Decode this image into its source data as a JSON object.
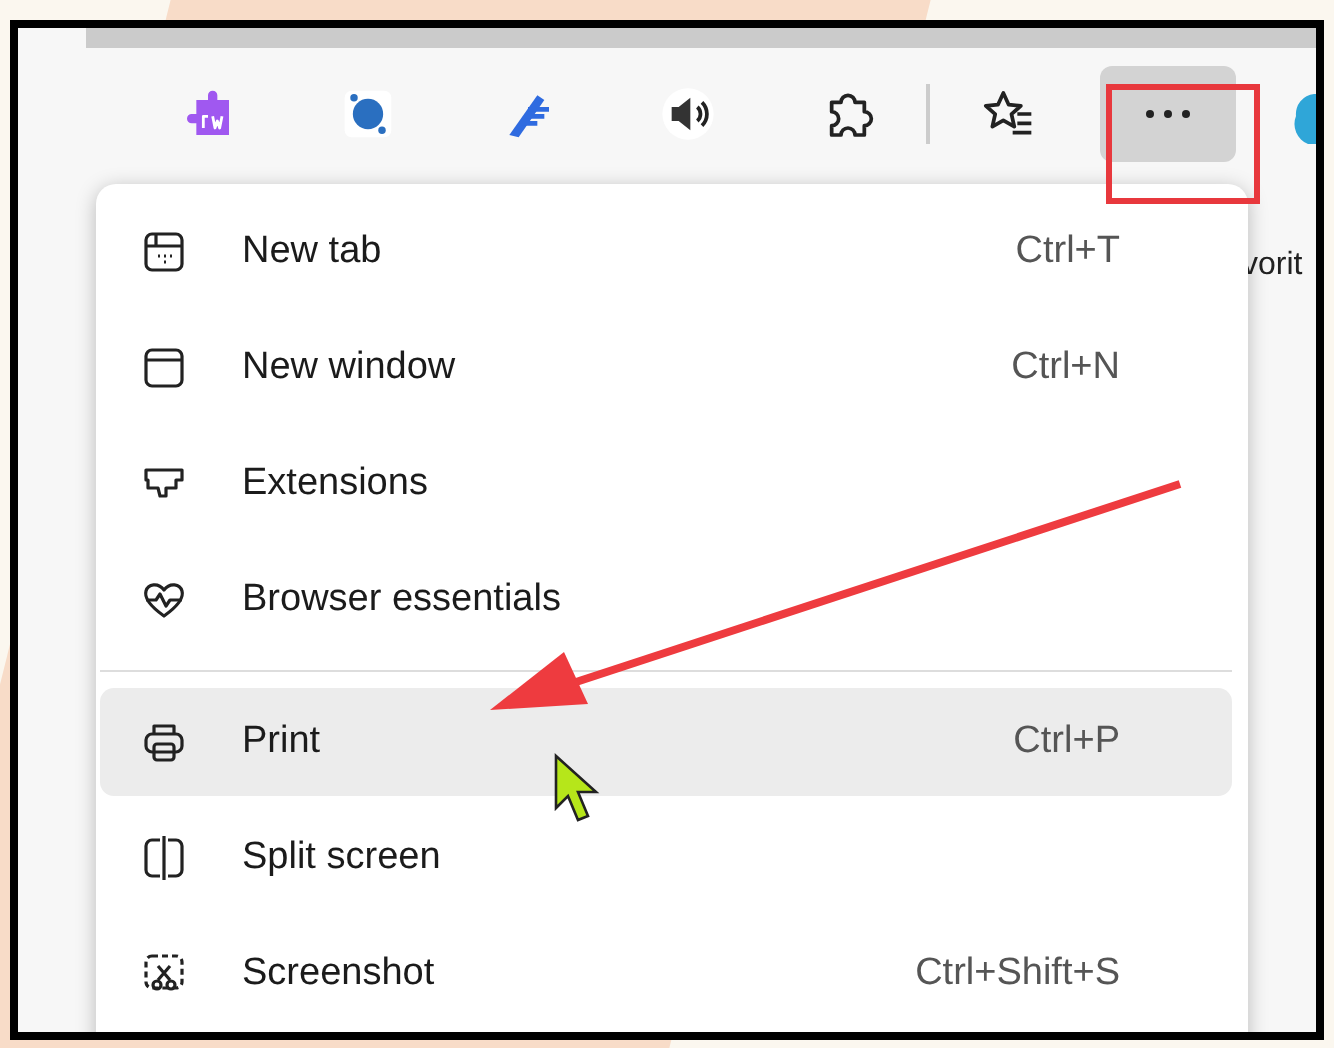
{
  "toolbar": {
    "more_button": {
      "pressed": true
    }
  },
  "bookmarks_bar": {
    "partial_label": "vorit"
  },
  "menu": {
    "items": [
      {
        "kind": "item",
        "label": "New tab",
        "shortcut": "Ctrl+T",
        "selected": false
      },
      {
        "kind": "item",
        "label": "New window",
        "shortcut": "Ctrl+N",
        "selected": false
      },
      {
        "kind": "item",
        "label": "Extensions",
        "selected": false
      },
      {
        "kind": "item",
        "label": "Browser essentials",
        "selected": false
      },
      {
        "kind": "divider"
      },
      {
        "kind": "item",
        "label": "Print",
        "shortcut": "Ctrl+P",
        "selected": true
      },
      {
        "kind": "item",
        "label": "Split screen",
        "selected": false
      },
      {
        "kind": "item",
        "label": "Screenshot",
        "shortcut": "Ctrl+Shift+S",
        "selected": false
      }
    ]
  }
}
